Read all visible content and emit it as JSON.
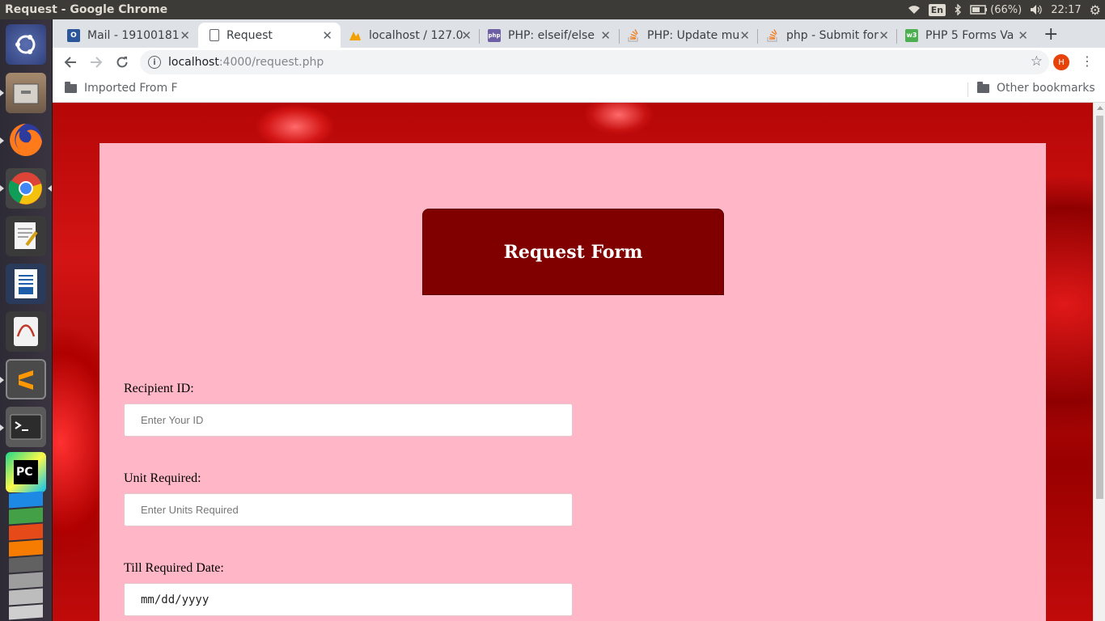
{
  "window": {
    "title": "Request - Google Chrome"
  },
  "tray": {
    "lang": "En",
    "battery": "(66%)",
    "time": "22:17"
  },
  "launcher": {
    "apps": [
      "ubuntu-dash-icon",
      "files-icon",
      "firefox-icon",
      "chrome-icon",
      "text-editor-icon",
      "writer-icon",
      "document-viewer-icon",
      "sublime-icon",
      "terminal-icon",
      "pycharm-icon"
    ]
  },
  "tabs": [
    {
      "label": "Mail - 19100181",
      "icon_text": "O",
      "icon_color": "#2b579a"
    },
    {
      "label": "Request",
      "icon_text": "",
      "icon_color": "#ffffff"
    },
    {
      "label": "localhost / 127.0",
      "icon_text": "",
      "icon_color": "#f2a100"
    },
    {
      "label": "PHP: elseif/else",
      "icon_text": "php",
      "icon_color": "#6d5fa3"
    },
    {
      "label": "PHP: Update mu",
      "icon_text": "",
      "icon_color": "#f48024"
    },
    {
      "label": "php - Submit for",
      "icon_text": "",
      "icon_color": "#f48024"
    },
    {
      "label": "PHP 5 Forms Va",
      "icon_text": "w3",
      "icon_color": "#4caf50"
    }
  ],
  "address": {
    "host": "localhost",
    "path": ":4000/request.php"
  },
  "profile_initial": "H",
  "bookmarks": {
    "left": "Imported From F",
    "right": "Other bookmarks"
  },
  "form": {
    "title": "Request Form",
    "recipient_label": "Recipient ID:",
    "recipient_placeholder": "Enter Your ID",
    "units_label": "Unit Required:",
    "units_placeholder": "Enter Units Required",
    "date_label": "Till Required Date:",
    "date_placeholder": "mm/dd/yyyy"
  },
  "colors": {
    "card": "#ffb6c6",
    "title_box": "#800000",
    "background": "#b50606"
  }
}
